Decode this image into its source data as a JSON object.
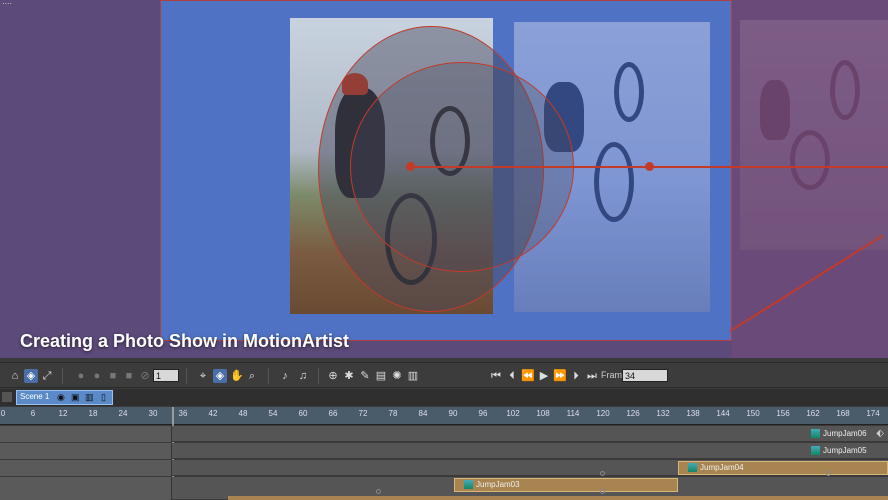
{
  "stage": {
    "title": "Creating a Photo Show in MotionArtist",
    "top_label": "...."
  },
  "toolbar": {
    "select_icon": "select-icon",
    "zoom_value": "1",
    "frame_label": "Frame",
    "frame_value": "34"
  },
  "scene": {
    "tab_label": "Scene 1"
  },
  "ruler": {
    "ticks": [
      "0",
      "6",
      "12",
      "18",
      "24",
      "30",
      "36",
      "42",
      "48",
      "54",
      "60",
      "66",
      "72",
      "78",
      "84",
      "90",
      "96",
      "102",
      "108",
      "114",
      "120",
      "126",
      "132",
      "138",
      "144",
      "150",
      "156",
      "162",
      "168",
      "174"
    ]
  },
  "tracks": [
    {
      "label": "JumpJam06"
    },
    {
      "label": "JumpJam05"
    },
    {
      "label": "JumpJam04"
    },
    {
      "label": "JumpJam03"
    }
  ],
  "colors": {
    "canvas": "#4f72c4",
    "motion_path": "#c23a2a",
    "clip": "#a88550"
  }
}
